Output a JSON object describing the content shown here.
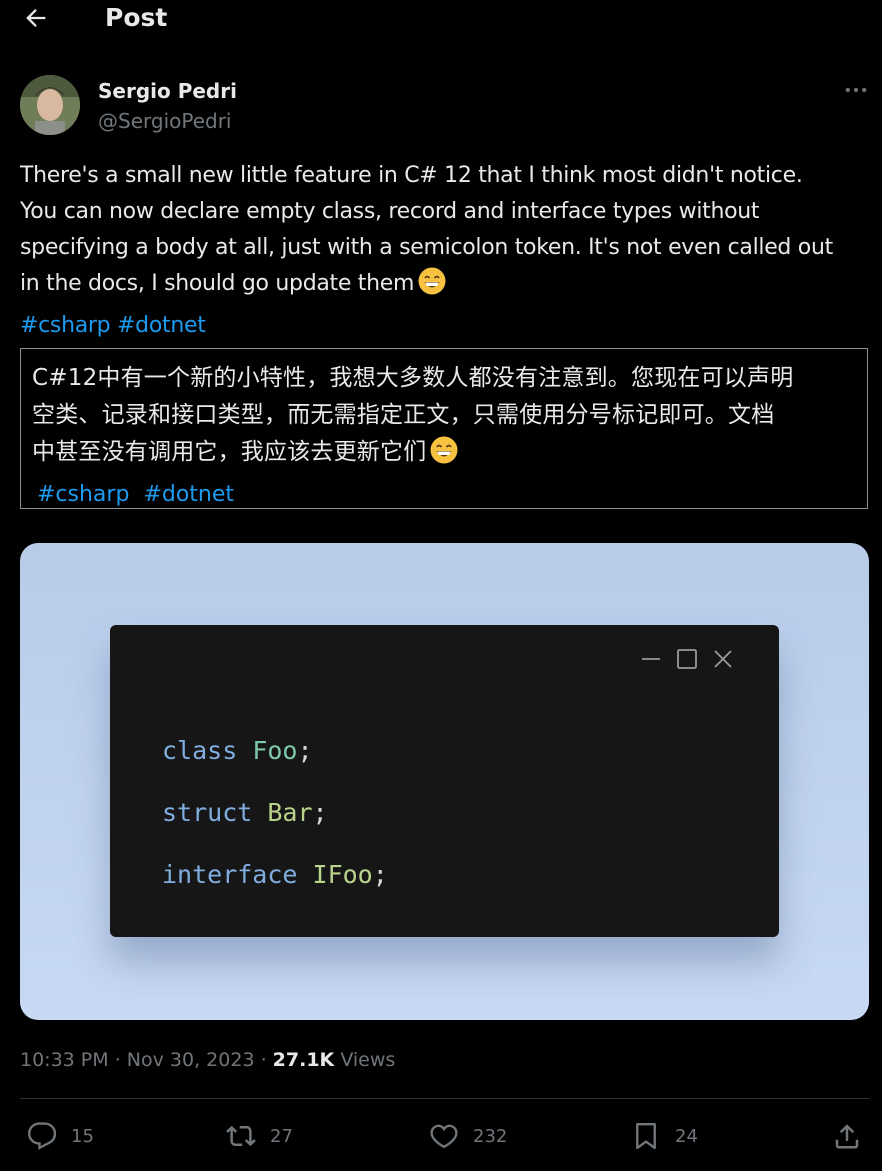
{
  "header": {
    "title": "Post"
  },
  "author": {
    "name": "Sergio Pedri",
    "handle": "@SergioPedri"
  },
  "tweet": {
    "text_lines": [
      "There's a small new little feature in C# 12 that I think most didn't notice.",
      "You can now declare empty class, record and interface types without",
      "specifying a body at all, just with a semicolon token. It's not even called out",
      "in the docs, I should go update them"
    ],
    "hashtags": [
      "#csharp",
      "#dotnet"
    ]
  },
  "translation": {
    "lines": [
      "C#12中有一个新的小特性，我想大多数人都没有注意到。您现在可以声明",
      "空类、记录和接口类型，而无需指定正文，只需使用分号标记即可。文档",
      "中甚至没有调用它，我应该去更新它们"
    ],
    "hashtags": [
      "#csharp",
      "#dotnet"
    ]
  },
  "media": {
    "code_lines": [
      {
        "keyword": "class",
        "name": "Foo",
        "punct": ";"
      },
      {
        "keyword": "struct",
        "name": "Bar",
        "punct": ";"
      },
      {
        "keyword": "interface",
        "name": "IFoo",
        "punct": ";"
      }
    ]
  },
  "meta": {
    "time": "10:33 PM",
    "sep": "·",
    "date": "Nov 30, 2023",
    "views_count": "27.1K",
    "views_label": "Views"
  },
  "actions": {
    "replies": "15",
    "reposts": "27",
    "likes": "232",
    "bookmarks": "24"
  },
  "icons": [
    "back-arrow-icon",
    "more-icon",
    "emoji-grin-icon",
    "minimize-icon",
    "maximize-icon",
    "close-icon",
    "reply-icon",
    "repost-icon",
    "like-icon",
    "bookmark-icon",
    "share-icon"
  ],
  "colors": {
    "background": "#000000",
    "text": "#e7e9ea",
    "secondary": "#71767b",
    "link": "#1d9bf0",
    "divider": "#2f3336"
  }
}
